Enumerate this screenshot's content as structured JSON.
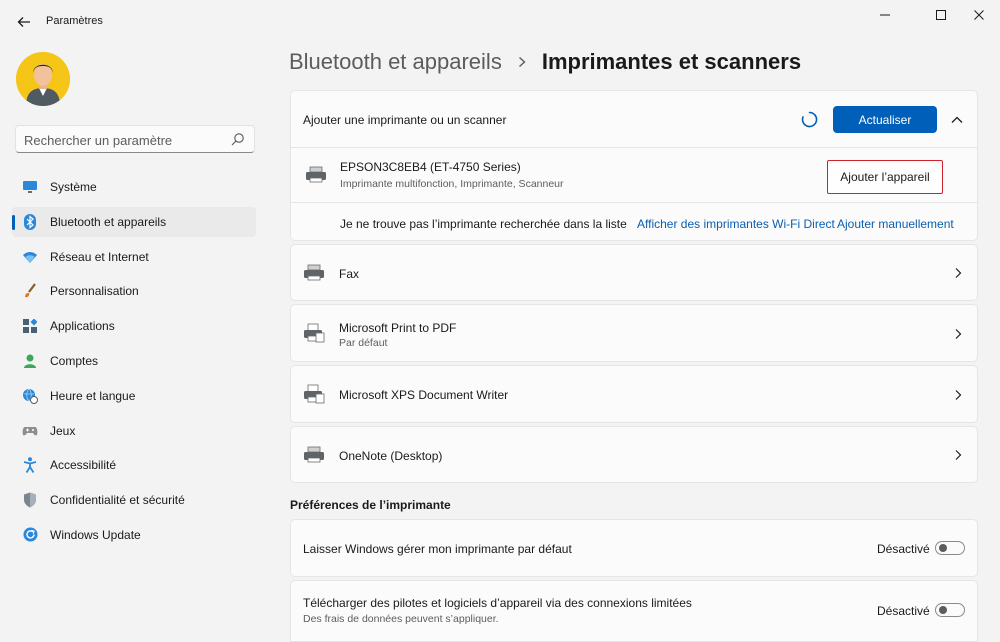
{
  "app": {
    "title": "Paramètres"
  },
  "search": {
    "placeholder": "Rechercher un paramètre"
  },
  "sidebar": {
    "items": [
      {
        "label": "Système",
        "icon": "monitor-icon",
        "active": false
      },
      {
        "label": "Bluetooth et appareils",
        "icon": "bluetooth-icon",
        "active": true
      },
      {
        "label": "Réseau et Internet",
        "icon": "wifi-icon",
        "active": false
      },
      {
        "label": "Personnalisation",
        "icon": "brush-icon",
        "active": false
      },
      {
        "label": "Applications",
        "icon": "apps-icon",
        "active": false
      },
      {
        "label": "Comptes",
        "icon": "person-icon",
        "active": false
      },
      {
        "label": "Heure et langue",
        "icon": "globe-clock-icon",
        "active": false
      },
      {
        "label": "Jeux",
        "icon": "gamepad-icon",
        "active": false
      },
      {
        "label": "Accessibilité",
        "icon": "accessibility-icon",
        "active": false
      },
      {
        "label": "Confidentialité et sécurité",
        "icon": "shield-icon",
        "active": false
      },
      {
        "label": "Windows Update",
        "icon": "update-icon",
        "active": false
      }
    ]
  },
  "breadcrumb": {
    "parent": "Bluetooth et appareils",
    "current": "Imprimantes et scanners"
  },
  "add_section": {
    "title": "Ajouter une imprimante ou un scanner",
    "refresh_label": "Actualiser",
    "found_device": {
      "name": "EPSON3C8EB4 (ET-4750 Series)",
      "description": "Imprimante multifonction, Imprimante, Scanneur",
      "add_label": "Ajouter l’appareil"
    },
    "not_listed_text": "Je ne trouve pas l’imprimante recherchée dans la liste",
    "wifi_direct_link": "Afficher des imprimantes Wi-Fi Direct",
    "manual_link": "Ajouter manuellement"
  },
  "printers": [
    {
      "name": "Fax",
      "subtitle": ""
    },
    {
      "name": "Microsoft Print to PDF",
      "subtitle": "Par défaut"
    },
    {
      "name": "Microsoft XPS Document Writer",
      "subtitle": ""
    },
    {
      "name": "OneNote (Desktop)",
      "subtitle": ""
    }
  ],
  "preferences": {
    "title": "Préférences de l’imprimante",
    "items": [
      {
        "label": "Laisser Windows gérer mon imprimante par défaut",
        "sublabel": "",
        "state": "Désactivé",
        "on": false
      },
      {
        "label": "Télécharger des pilotes et logiciels d’appareil via des connexions limitées",
        "sublabel": "Des frais de données peuvent s’appliquer.",
        "state": "Désactivé",
        "on": false
      }
    ]
  },
  "colors": {
    "accent": "#005fb8",
    "highlight_border": "#d0212a",
    "link": "#0a5fb0",
    "background": "#f3f3f3",
    "card": "#fbfbfb"
  }
}
